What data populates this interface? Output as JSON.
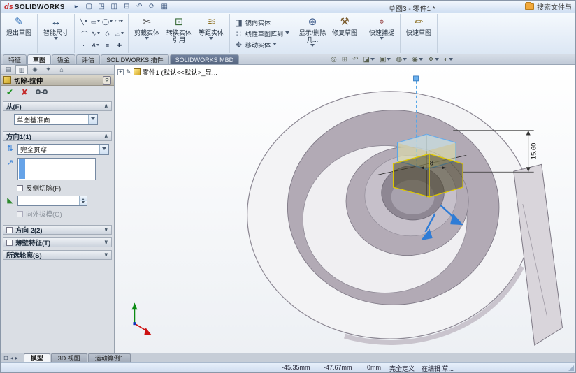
{
  "window": {
    "logo_mark": "ds",
    "logo_text": "SOLIDWORKS",
    "title": "草图3 - 零件1 *",
    "search_text": "搜索文件与"
  },
  "icons": {
    "ok": "✔",
    "cancel": "✘",
    "reverse": "⇅",
    "direction": "↗",
    "draft": "◣",
    "quickbar": [
      "▸",
      "▢",
      "◳",
      "◫",
      "⊟",
      "↶",
      "⟳",
      "▦"
    ],
    "pm_tabs": [
      "▤",
      "▥",
      "◈",
      "✦",
      "⌂"
    ],
    "headsup": [
      "◎",
      "⊞",
      "↶",
      "◪",
      "▣",
      "◍",
      "◉",
      "❖",
      "◐"
    ],
    "sketch_grid": [
      "╲",
      "▭",
      "◯",
      "◠",
      "⌒",
      "∿",
      "◇",
      "⌓",
      "·",
      "A",
      "≡",
      "✚"
    ],
    "bottom_nav": [
      "⊞",
      "◂",
      "▸"
    ],
    "expander_plus": "+"
  },
  "ribbon": {
    "exit_sketch": {
      "label": "退出草图",
      "glyph": "✎"
    },
    "smart_dimension": {
      "label": "智能尺寸",
      "glyph": "↔"
    },
    "trim": {
      "label": "剪裁实体",
      "glyph": "✂"
    },
    "convert": {
      "label": "转换实体引用",
      "glyph": "⊡"
    },
    "offset": {
      "label": "等距实体",
      "glyph": "≋"
    },
    "mirror": {
      "label": "镜向实体",
      "glyph": "◨"
    },
    "linear_pattern": {
      "label": "线性草图阵列",
      "glyph": "∷"
    },
    "move": {
      "label": "移动实体",
      "glyph": "✥"
    },
    "display_delete": {
      "label": "显示/删除几...",
      "glyph": "⊛"
    },
    "repair": {
      "label": "修复草图",
      "glyph": "⚒"
    },
    "quick_snaps": {
      "label": "快速捕捉",
      "glyph": "⌖"
    },
    "rapid_sketch": {
      "label": "快速草图",
      "glyph": "✏"
    }
  },
  "tabs": {
    "items": [
      {
        "label": "特征"
      },
      {
        "label": "草图"
      },
      {
        "label": "钣金"
      },
      {
        "label": "评估"
      },
      {
        "label": "SOLIDWORKS 插件"
      },
      {
        "label": "SOLIDWORKS MBD"
      }
    ]
  },
  "property_manager": {
    "title": "切除-拉伸",
    "help": "?",
    "from": {
      "title": "从(F)",
      "value": "草图基准面"
    },
    "direction1": {
      "title": "方向1(1)",
      "value": "完全贯穿",
      "flip_label": "反侧切除(F)",
      "draft_label": "向外拔模(O)"
    },
    "direction2": {
      "title": "方向 2(2)"
    },
    "thin": {
      "title": "薄壁特征(T)"
    },
    "contours": {
      "title": "所选轮廓(S)"
    }
  },
  "feature_tree": {
    "root": "零件1 (默认<<默认>_显..."
  },
  "viewport": {
    "dim_height": "15.60",
    "dim_width": "8"
  },
  "bottom_tabs": {
    "items": [
      {
        "label": "模型"
      },
      {
        "label": "3D 视图"
      },
      {
        "label": "运动算例1"
      }
    ]
  },
  "status_bar": {
    "x": "-45.35mm",
    "y": "-47.67mm",
    "z": "0mm",
    "state": "完全定义",
    "mode": "在编辑 草..."
  },
  "colors": {
    "accent_blue": "#2f7cd6",
    "sketch_yellow": "#ddc800",
    "preview_blue": "#5aa7e8",
    "ok_green": "#18911e",
    "cancel_red": "#c42b2b"
  }
}
